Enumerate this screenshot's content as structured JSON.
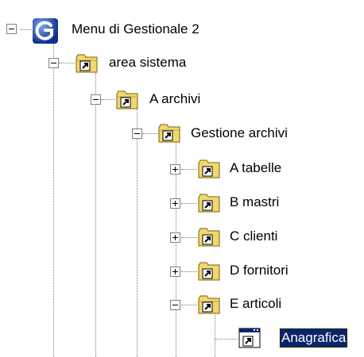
{
  "tree": {
    "nodes": [
      {
        "label": "Menu di Gestionale 2",
        "icon": "gestionale-logo-icon",
        "state": "expanded"
      },
      {
        "label": "area sistema",
        "icon": "folder-shortcut-icon",
        "state": "expanded"
      },
      {
        "label": "A archivi",
        "icon": "folder-shortcut-icon",
        "state": "expanded"
      },
      {
        "label": "Gestione archivi",
        "icon": "folder-shortcut-icon",
        "state": "expanded"
      },
      {
        "label": "A tabelle",
        "icon": "folder-shortcut-icon",
        "state": "collapsed"
      },
      {
        "label": "B mastri",
        "icon": "folder-shortcut-icon",
        "state": "collapsed"
      },
      {
        "label": "C clienti",
        "icon": "folder-shortcut-icon",
        "state": "collapsed"
      },
      {
        "label": "D fornitori",
        "icon": "folder-shortcut-icon",
        "state": "collapsed"
      },
      {
        "label": "E articoli",
        "icon": "folder-shortcut-icon",
        "state": "expanded"
      },
      {
        "label": "Anagrafica",
        "icon": "window-shortcut-icon",
        "state": "leaf",
        "selected": true
      }
    ]
  },
  "colors": {
    "selection_background": "#0a246a",
    "selection_text": "#ffffff",
    "connector": "#7a7a7a",
    "folder": "#f0d870"
  }
}
